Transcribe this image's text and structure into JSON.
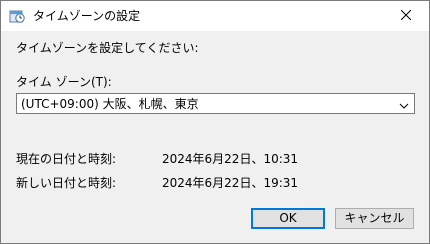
{
  "window": {
    "title": "タイムゾーンの設定",
    "close_icon": "close-icon",
    "app_icon": "clock-icon"
  },
  "content": {
    "instruction": "タイムゾーンを設定してください:",
    "timezone_label": "タイム ゾーン(T):",
    "timezone_selected": "(UTC+09:00) 大阪、札幌、東京",
    "current_label": "現在の日付と時刻:",
    "current_value": "2024年6月22日、10:31",
    "new_label": "新しい日付と時刻:",
    "new_value": "2024年6月22日、19:31"
  },
  "buttons": {
    "ok": "OK",
    "cancel": "キャンセル"
  },
  "colors": {
    "accent": "#0078d7",
    "dialog_bg": "#f0f0f0",
    "button_bg": "#e1e1e1"
  }
}
